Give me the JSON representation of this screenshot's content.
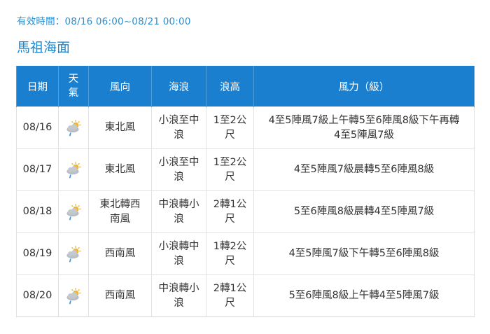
{
  "validity_text": "有效時間：08/16 06:00~08/21 00:00",
  "region_title": "馬祖海面",
  "headers": {
    "date": "日期",
    "weather_top": "天",
    "weather_bottom": "氣",
    "wind_dir": "風向",
    "wave": "海浪",
    "wave_height": "浪高",
    "wind_force": "風力（級）"
  },
  "weather_icon": "partly-cloudy-showers-icon",
  "colors": {
    "header_bg": "#1a7fcf",
    "title_blue": "#1e88cf",
    "sun": "#f2b630",
    "cloud": "#b9bec4",
    "rain": "#3c8fd6"
  },
  "rows": [
    {
      "date": "08/16",
      "wind_dir": [
        "東北風"
      ],
      "wave": [
        "小浪至中",
        "浪"
      ],
      "wave_height": [
        "1至2公",
        "尺"
      ],
      "wind_force": [
        "4至5陣風7級上午轉5至6陣風8級下午再轉",
        "4至5陣風7級"
      ]
    },
    {
      "date": "08/17",
      "wind_dir": [
        "東北風"
      ],
      "wave": [
        "小浪至中",
        "浪"
      ],
      "wave_height": [
        "1至2公",
        "尺"
      ],
      "wind_force": [
        "4至5陣風7級晨轉5至6陣風8級"
      ]
    },
    {
      "date": "08/18",
      "wind_dir": [
        "東北轉西",
        "南風"
      ],
      "wave": [
        "中浪轉小",
        "浪"
      ],
      "wave_height": [
        "2轉1公",
        "尺"
      ],
      "wind_force": [
        "5至6陣風8級晨轉4至5陣風7級"
      ]
    },
    {
      "date": "08/19",
      "wind_dir": [
        "西南風"
      ],
      "wave": [
        "小浪轉中",
        "浪"
      ],
      "wave_height": [
        "1轉2公",
        "尺"
      ],
      "wind_force": [
        "4至5陣風7級下午轉5至6陣風8級"
      ]
    },
    {
      "date": "08/20",
      "wind_dir": [
        "西南風"
      ],
      "wave": [
        "中浪轉小",
        "浪"
      ],
      "wave_height": [
        "2轉1公",
        "尺"
      ],
      "wind_force": [
        "5至6陣風8級上午轉4至5陣風7級"
      ]
    }
  ]
}
